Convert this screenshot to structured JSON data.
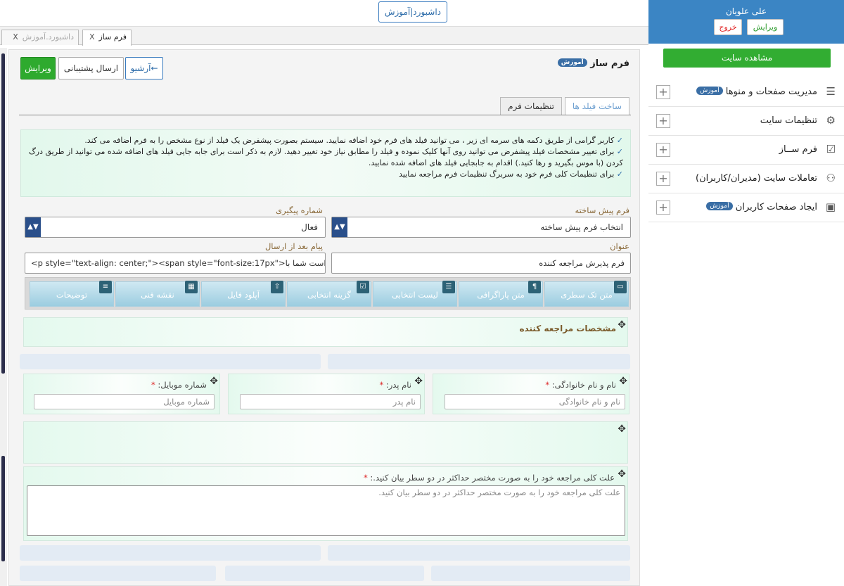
{
  "topbar": {
    "dashboard_link": "داشبورد|آموزش"
  },
  "tabs": [
    {
      "label": "داشبورد.آموزش",
      "close": "X"
    },
    {
      "label": "فرم ساز",
      "close": "X"
    }
  ],
  "header": {
    "title": "فرم ساز",
    "badge": "آموزش"
  },
  "actions": {
    "edit": "ویرایش",
    "send_support": "ارسال پشتیبانی",
    "archive": "آرشیو←"
  },
  "form_tabs": {
    "build_fields": "ساخت فیلد ها",
    "form_settings": "تنظیمات فرم"
  },
  "info": [
    "کاربر گرامی از طریق دکمه های سرمه ای زیر ، می توانید فیلد های فرم خود اضافه نمایید. سیستم بصورت پیشفرض یک فیلد از نوع مشخص را به فرم اضافه می کند.",
    "برای تغییر مشخصات فیلد پیشفرض می توانید روی آنها کلیک نموده و فیلد را مطابق نیاز خود تغییر دهید. لازم به ذکر است برای جابه جایی فیلد های اضافه شده می توانید از طریق درگ کردن (با موس بگیرید و رها کنید.) اقدام به جابجایی فیلد های اضافه شده نمایید.",
    "برای تنظیمات کلی فرم خود به سربرگ تنظیمات فرم مراجعه نمایید"
  ],
  "form": {
    "prebuilt_label": "فرم پیش ساخته",
    "prebuilt_value": "انتخاب فرم پیش ساخته",
    "tracking_label": "شماره پیگیری",
    "tracking_value": "فعال",
    "title_label": "عنوان",
    "title_value": "فرم پذیرش مراجعه کننده",
    "after_send_label": "پیام بعد از ارسال",
    "after_send_value": "<p style=\"text-align: center;\"><span style=\"font-size:17px\">درخواست شما با"
  },
  "field_buttons": [
    {
      "label": "متن تک سطری",
      "icon": "text-line-icon"
    },
    {
      "label": "متن پاراگرافی",
      "icon": "paragraph-icon"
    },
    {
      "label": "لیست انتخابی",
      "icon": "list-icon"
    },
    {
      "label": "گزینه انتخابی",
      "icon": "checkbox-icon"
    },
    {
      "label": "آپلود فایل",
      "icon": "upload-icon"
    },
    {
      "label": "نقشه فنی",
      "icon": "map-icon"
    },
    {
      "label": "توضیحات",
      "icon": "document-icon"
    }
  ],
  "sections": {
    "heading": "مشخصات مراجعه کننده",
    "fullname_label": "نام و نام خانوادگی:",
    "fullname_placeholder": "نام و نام خانوادگی",
    "father_label": "نام پدر:",
    "father_placeholder": "نام پدر",
    "mobile_label": "شماره موبایل:",
    "mobile_placeholder": "شماره موبایل",
    "reason_label": "علت کلی مراجعه خود را به صورت مختصر حداکثر در دو سطر بیان کنید.:",
    "reason_placeholder": "علت کلی مراجعه خود را به صورت مختصر حداکثر در دو سطر بیان کنید.",
    "required": "*"
  },
  "sidebar": {
    "user_name": "علی علویان",
    "edit": "ویرایش",
    "logout": "خروج",
    "view_site": "مشاهده سایت",
    "items": [
      {
        "label": "مدیریت صفحات و منوها",
        "badge": "آموزش",
        "icon": "pages-icon"
      },
      {
        "label": "تنظیمات سایت",
        "icon": "gear-icon"
      },
      {
        "label": "فرم ســاز",
        "icon": "checkbox-icon"
      },
      {
        "label": "تعاملات سایت (مدیران/کاربران)",
        "icon": "users-icon"
      },
      {
        "label": "ایجاد صفحات کاربران",
        "badge": "آموزش",
        "icon": "id-card-icon"
      }
    ]
  },
  "colors": {
    "accent": "#3b85c4",
    "green": "#2eaa2e",
    "navy": "#2a4f8a"
  }
}
